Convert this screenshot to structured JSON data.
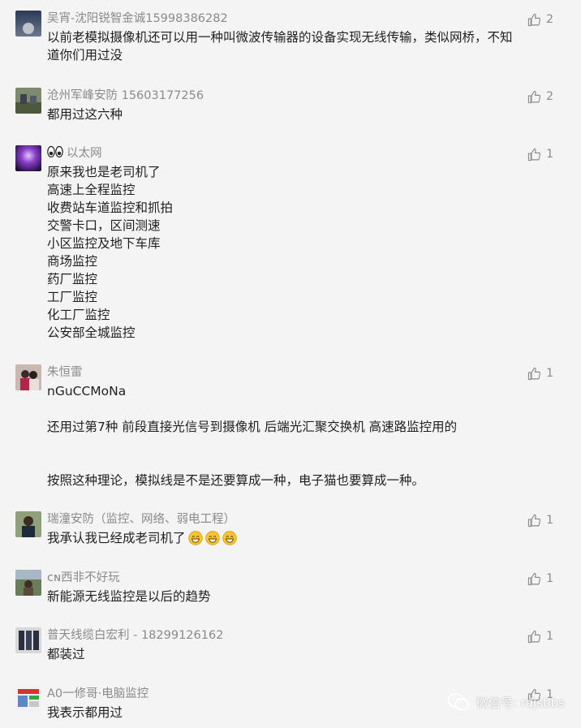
{
  "comments": [
    {
      "nickname": "吴宵-沈阳锐智金诚15998386282",
      "likes": "2",
      "lines": [
        "以前老模拟摄像机还可以用一种叫微波传输器的设备实现无线传输，类似网桥，不知",
        "道你们用过没"
      ]
    },
    {
      "nickname": "沧州军峰安防 15603177256",
      "likes": "2",
      "lines": [
        "都用过这六种"
      ]
    },
    {
      "nickname": "以太网",
      "nickname_prefix_icon": "eyes-emoji-icon",
      "likes": "1",
      "lines": [
        "原来我也是老司机了",
        "高速上全程监控",
        "收费站车道监控和抓拍",
        "交警卡口，区间测速",
        "小区监控及地下车库",
        "商场监控",
        "药厂监控",
        "工厂监控",
        "化工厂监控",
        "公安部全城监控"
      ]
    },
    {
      "nickname": "朱恒雷",
      "likes": "1",
      "lines": [
        "nGuCCMoNa",
        "",
        "还用过第7种   前段直接光信号到摄像机   后端光汇聚交换机   高速路监控用的",
        "",
        "",
        "按照这种理论，模拟线是不是还要算成一种，电子猫也要算成一种。"
      ]
    },
    {
      "nickname": "瑞潼安防（监控、网络、弱电工程）",
      "likes": "1",
      "lines": [
        "我承认我已经成老司机了"
      ],
      "trailing_emoji": "grin-emoji-icon"
    },
    {
      "nickname": "ᴄɴ西非不好玩",
      "likes": "1",
      "lines": [
        "新能源无线监控是以后的趋势"
      ]
    },
    {
      "nickname": "普天线缆白宏利 - 18299126162",
      "likes": "1",
      "lines": [
        "都装过"
      ]
    },
    {
      "nickname": "A0一修哥·电脑监控",
      "likes": "1",
      "lines": [
        "我表示都用过"
      ]
    }
  ],
  "watermark": "微信号: rdjsbbs",
  "colors": {
    "nickname": "#8a8a8a",
    "text": "#1f1f1f",
    "background": "#f4f4f4"
  }
}
